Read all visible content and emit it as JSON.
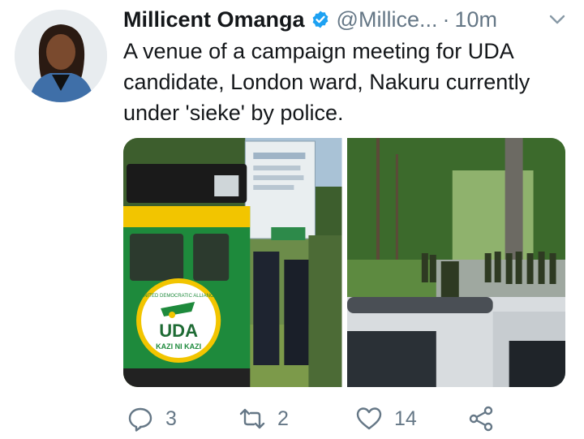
{
  "tweet": {
    "author_name": "Millicent Omanga",
    "handle": "@Millice...",
    "separator": "·",
    "time": "10m",
    "text": "A venue of a campaign meeting for UDA candidate, London ward, Nakuru currently under 'sieke' by police."
  },
  "media": {
    "photo1": {
      "vehicle_logo_top": "UNITED DEMOCRATIC ALLIANCE",
      "vehicle_logo_main": "UDA",
      "vehicle_logo_sub": "KAZI NI KAZI"
    }
  },
  "actions": {
    "reply_count": "3",
    "retweet_count": "2",
    "like_count": "14"
  },
  "colors": {
    "text": "#14171a",
    "secondary": "#657786",
    "verified": "#1da1f2",
    "uda_green": "#1e8a3c",
    "uda_yellow": "#f2c500"
  },
  "icons": [
    "verified-badge-icon",
    "chevron-down-icon",
    "reply-icon",
    "retweet-icon",
    "like-icon",
    "share-icon"
  ]
}
